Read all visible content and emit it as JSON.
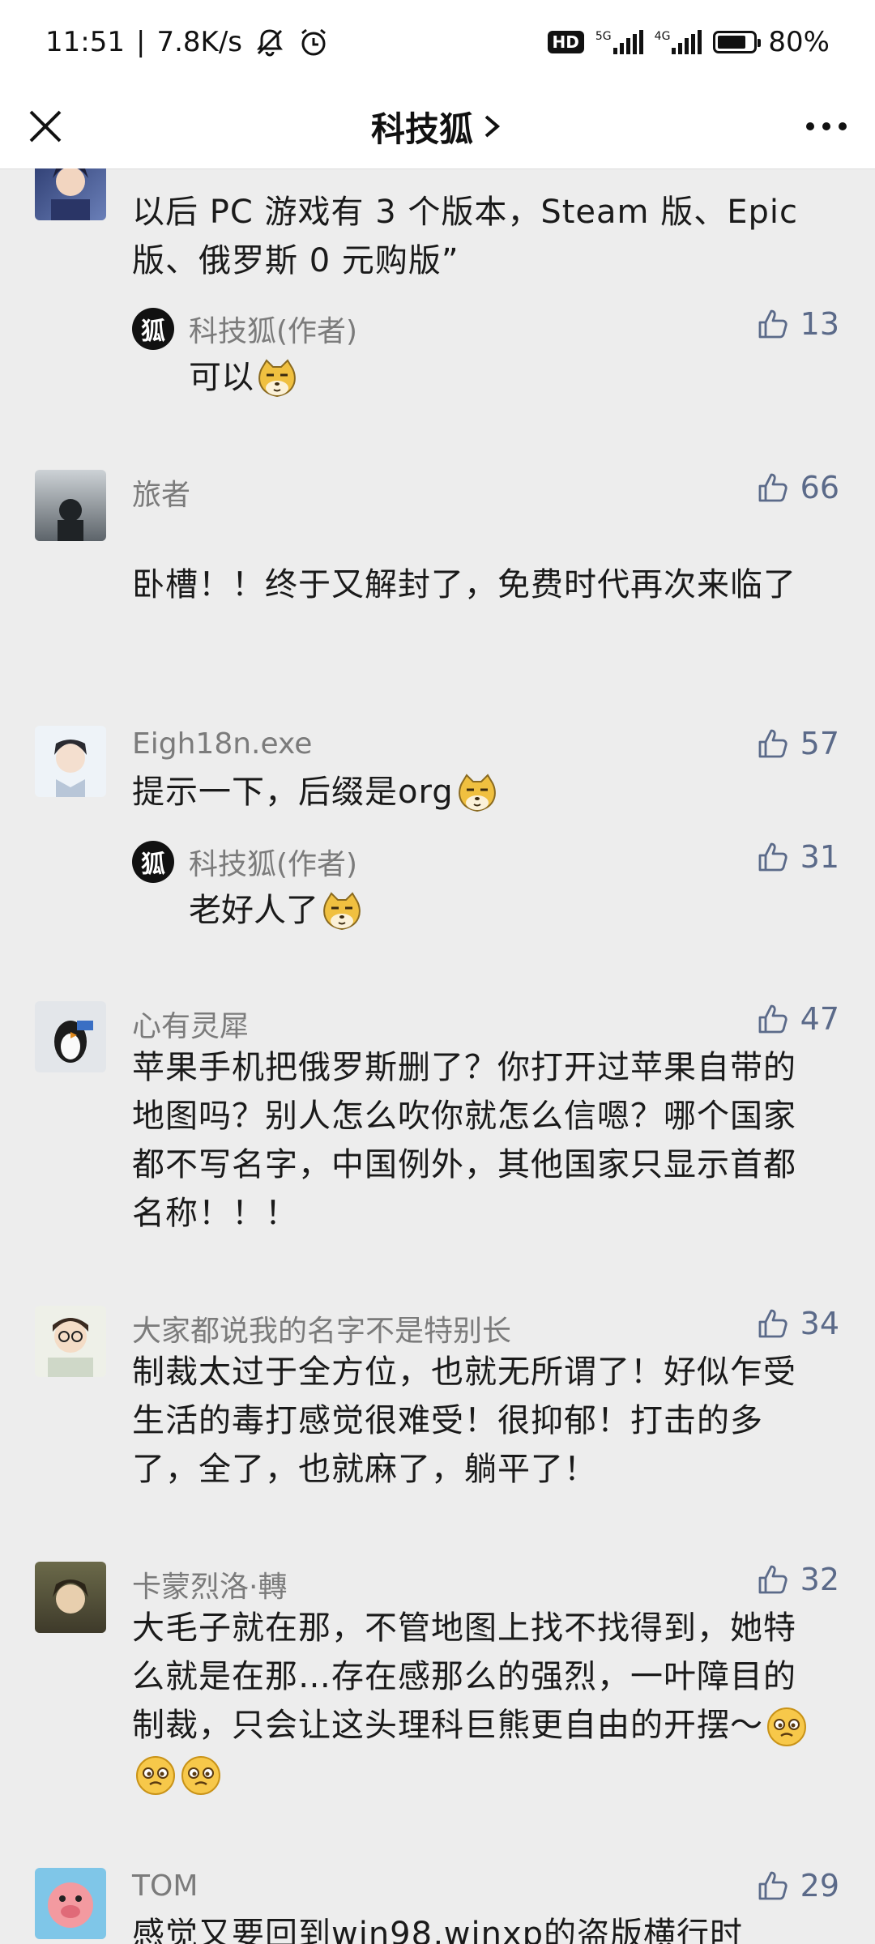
{
  "status_bar": {
    "time": "11:51",
    "speed": "7.8K/s",
    "network_5g": "5G",
    "network_4g": "4G",
    "hd_badge": "HD",
    "battery_text": "80%",
    "battery_level": 0.8
  },
  "title_bar": {
    "title": "科技狐",
    "close_icon": "close-icon",
    "more_icon": "more-icon"
  },
  "comments": [
    {
      "user": "",
      "likes": "",
      "text": "以后 PC 游戏有 3 个版本，Steam 版、Epic 版、俄罗斯 0 元购版”",
      "reply": {
        "author": "科技狐(作者)",
        "likes": "13",
        "text": "可以",
        "avatar_char": "狐"
      }
    },
    {
      "user": "旅者",
      "likes": "66",
      "text": "卧槽！！终于又解封了，免费时代再次来临了"
    },
    {
      "user": "Eigh18n.exe",
      "likes": "57",
      "text": "提示一下，后缀是org",
      "reply": {
        "author": "科技狐(作者)",
        "likes": "31",
        "text": "老好人了",
        "avatar_char": "狐"
      }
    },
    {
      "user": "心有灵犀",
      "likes": "47",
      "text": "苹果手机把俄罗斯删了？你打开过苹果自带的地图吗？别人怎么吹你就怎么信嗯？哪个国家都不写名字，中国例外，其他国家只显示首都名称！！！"
    },
    {
      "user": "大家都说我的名字不是特别长",
      "likes": "34",
      "text": "制裁太过于全方位，也就无所谓了！好似乍受生活的毒打感觉很难受！很抑郁！打击的多了，全了，也就麻了，躺平了！"
    },
    {
      "user": "卡蒙烈洛·轉",
      "likes": "32",
      "text": "大毛子就在那，不管地图上找不找得到，她特么就是在那…存在感那么的强烈，一叶障目的制裁，只会让这头理科巨熊更自由的开摆～"
    },
    {
      "user": "TOM",
      "likes": "29",
      "text": "感觉又要回到win98,winxp的盗版横行时"
    }
  ],
  "colors": {
    "background": "#ededed",
    "like_blue": "#5b6a89",
    "name_gray": "#7b7b7b"
  }
}
